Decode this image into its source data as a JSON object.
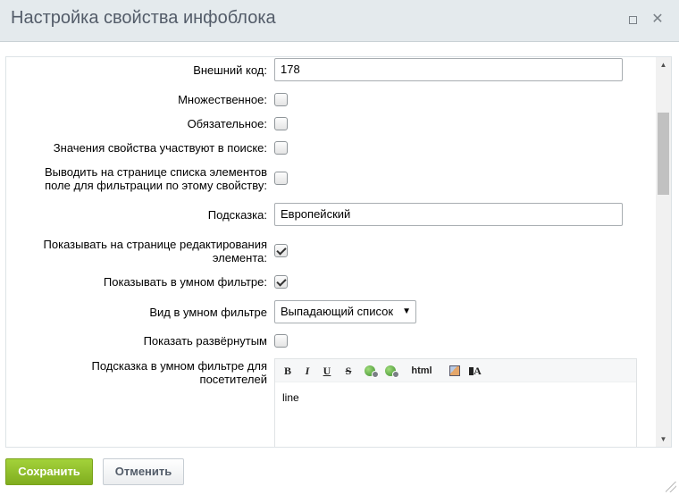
{
  "dialog": {
    "title": "Настройка свойства инфоблока"
  },
  "icons": {
    "maximize": "maximize-icon",
    "close": "close-icon",
    "scroll_up": "scroll-up-arrow",
    "scroll_down": "scroll-down-arrow"
  },
  "form": {
    "external_code": {
      "label": "Внешний код:",
      "value": "178"
    },
    "multiple": {
      "label": "Множественное:",
      "checked": false
    },
    "required": {
      "label": "Обязательное:",
      "checked": false
    },
    "searchable": {
      "label": "Значения свойства участвуют в поиске:",
      "checked": false
    },
    "filter_on_list": {
      "label_line1": "Выводить на странице списка элементов",
      "label_line2": "поле для фильтрации по этому свойству:",
      "checked": false
    },
    "hint": {
      "label": "Подсказка:",
      "value": "Европейский"
    },
    "show_on_edit": {
      "label_line1": "Показывать на странице редактирования",
      "label_line2": "элемента:",
      "checked": true
    },
    "show_in_smart_filter": {
      "label": "Показывать в умном фильтре:",
      "checked": true
    },
    "smart_filter_view": {
      "label": "Вид в умном фильтре",
      "value": "Выпадающий список"
    },
    "show_expanded": {
      "label": "Показать развёрнутым",
      "checked": false
    },
    "smart_filter_hint": {
      "label_line1": "Подсказка в умном фильтре для",
      "label_line2": "посетителей",
      "editor_text": "line",
      "toolbar": {
        "bold": "B",
        "italic": "I",
        "underline": "U",
        "strike": "S",
        "html": "html",
        "font": "A"
      }
    }
  },
  "buttons": {
    "save": "Сохранить",
    "cancel": "Отменить"
  },
  "colors": {
    "save_green": "#8dbb27",
    "title_gray": "#535c69"
  }
}
